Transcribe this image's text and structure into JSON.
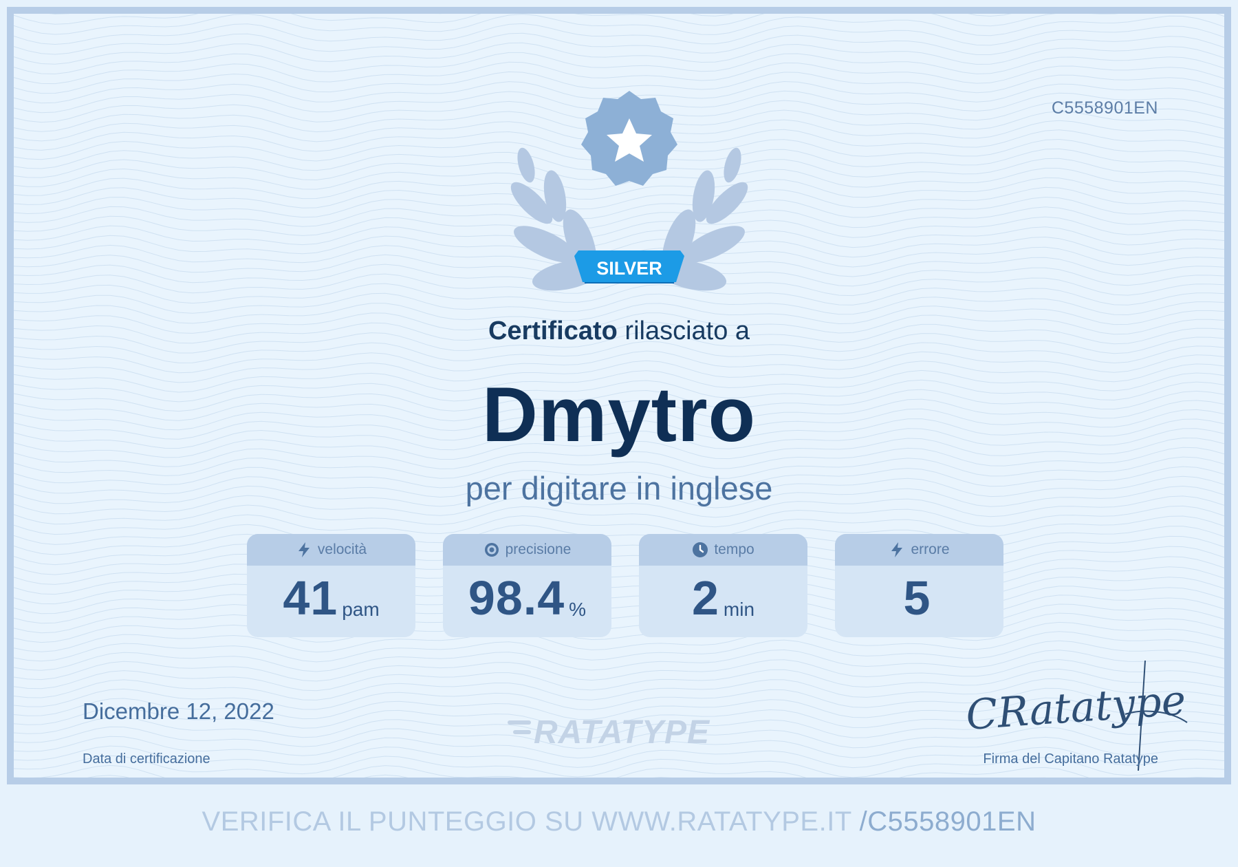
{
  "certificate": {
    "id": "C5558901EN",
    "badge_label": "SILVER",
    "headline_bold": "Certificato",
    "headline_rest": " rilasciato a",
    "recipient": "Dmytro",
    "subtitle": "per digitare in inglese",
    "date": "Dicembre 12, 2022",
    "date_label": "Data di certificazione",
    "logo_text": "RATATYPE",
    "signature_text": "CRatatype",
    "signature_label": "Firma del Capitano Ratatype"
  },
  "stats": [
    {
      "label": "velocità",
      "icon": "lightning-icon",
      "value": "41",
      "unit": "pam"
    },
    {
      "label": "precisione",
      "icon": "target-icon",
      "value": "98.4",
      "unit": "%"
    },
    {
      "label": "tempo",
      "icon": "clock-icon",
      "value": "2",
      "unit": "min"
    },
    {
      "label": "errore",
      "icon": "lightning-icon",
      "value": "5",
      "unit": ""
    }
  ],
  "footer": {
    "verify_text": "VERIFICA IL PUNTEGGIO SU WWW.RATATYPE.IT ",
    "verify_code": "/C5558901EN"
  },
  "colors": {
    "background": "#e9f4fd",
    "border": "#b7cde7",
    "name": "#0f2f55",
    "badge": "#1c9be6"
  }
}
